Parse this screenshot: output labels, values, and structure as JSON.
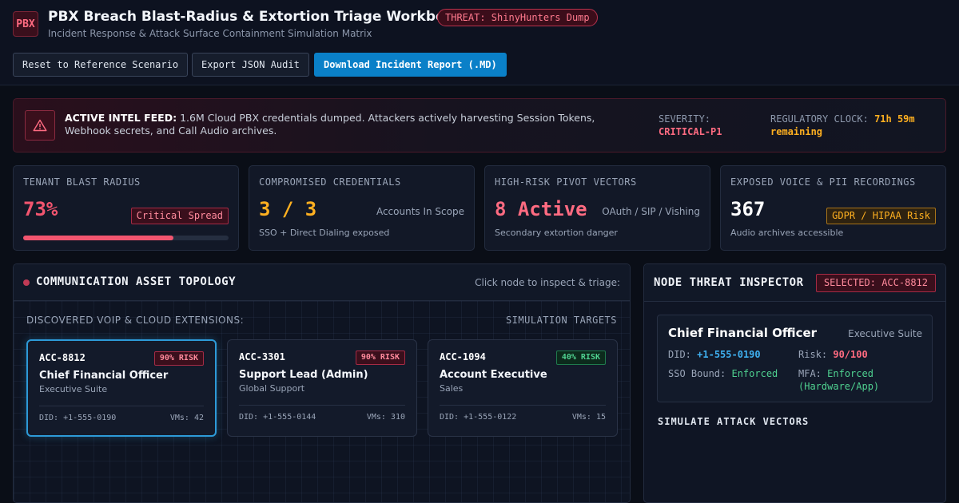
{
  "header": {
    "logo": "PBX",
    "title": "PBX Breach Blast-Radius & Extortion Triage Workbench",
    "threat_badge": "THREAT: ShinyHunters Dump",
    "subtitle": "Incident Response & Attack Surface Containment Simulation Matrix",
    "buttons": {
      "reset": "Reset to Reference Scenario",
      "export": "Export JSON Audit",
      "download": "Download Incident Report (.MD)"
    }
  },
  "intel": {
    "icon": "warning-icon",
    "heading": "ACTIVE INTEL FEED:",
    "message": "1.6M Cloud PBX credentials dumped. Attackers actively harvesting Session Tokens, Webhook secrets, and Call Audio archives.",
    "severity_label": "SEVERITY:",
    "severity_value": "CRITICAL-P1",
    "clock_label": "REGULATORY CLOCK:",
    "clock_value": "71h 59m remaining"
  },
  "kpis": {
    "blast": {
      "label": "TENANT BLAST RADIUS",
      "value": "73%",
      "tag": "Critical Spread",
      "progress_percent": 73
    },
    "creds": {
      "label": "COMPROMISED CREDENTIALS",
      "value": "3 / 3",
      "side": "Accounts In Scope",
      "foot": "SSO + Direct Dialing exposed"
    },
    "pivots": {
      "label": "HIGH-RISK PIVOT VECTORS",
      "value": "8 Active",
      "side": "OAuth / SIP / Vishing",
      "foot": "Secondary extortion danger"
    },
    "recordings": {
      "label": "EXPOSED VOICE & PII RECORDINGS",
      "value": "367",
      "tag": "GDPR / HIPAA Risk",
      "foot": "Audio archives accessible"
    }
  },
  "topology": {
    "title": "COMMUNICATION ASSET TOPOLOGY",
    "hint": "Click node to inspect & triage:",
    "extensions_label": "DISCOVERED VOIP & CLOUD EXTENSIONS:",
    "targets_label": "SIMULATION TARGETS",
    "accounts": [
      {
        "id": "ACC-8812",
        "risk": "90% RISK",
        "name": "Chief Financial Officer",
        "dept": "Executive Suite",
        "did": "DID: +1-555-0190",
        "vms": "VMs: 42"
      },
      {
        "id": "ACC-3301",
        "risk": "90% RISK",
        "name": "Support Lead (Admin)",
        "dept": "Global Support",
        "did": "DID: +1-555-0144",
        "vms": "VMs: 310"
      },
      {
        "id": "ACC-1094",
        "risk": "40% RISK",
        "name": "Account Executive",
        "dept": "Sales",
        "did": "DID: +1-555-0122",
        "vms": "VMs: 15"
      }
    ]
  },
  "inspector": {
    "title": "NODE THREAT INSPECTOR",
    "selected": "SELECTED: ACC-8812",
    "name": "Chief Financial Officer",
    "dept": "Executive Suite",
    "did_label": "DID:",
    "did_value": "+1-555-0190",
    "risk_label": "Risk:",
    "risk_value": "90/100",
    "sso_label": "SSO Bound:",
    "sso_value": "Enforced",
    "mfa_label": "MFA:",
    "mfa_value_1": "Enforced",
    "mfa_value_2": "(Hardware/App)",
    "simulate_heading": "SIMULATE ATTACK VECTORS"
  },
  "colors": {
    "critical": "#ff6b81",
    "warning": "#ffb020",
    "safe": "#4fd190",
    "accent": "#0a80c8"
  }
}
